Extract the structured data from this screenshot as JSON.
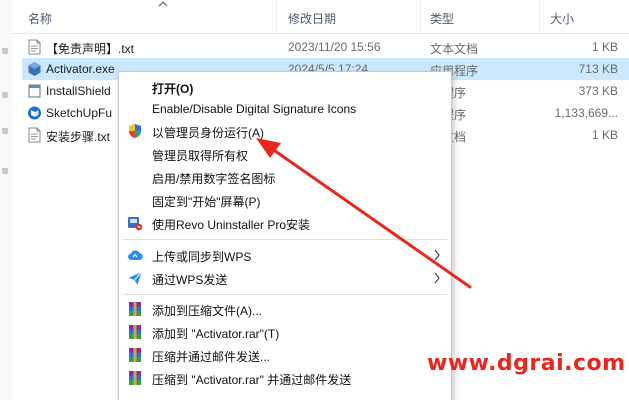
{
  "header": {
    "col_name": "名称",
    "col_date": "修改日期",
    "col_type": "类型",
    "col_size": "大小"
  },
  "files": [
    {
      "name": "【免责声明】.txt",
      "date": "2023/11/20 15:56",
      "type": "文本文档",
      "size": "1 KB",
      "icon": "text-file-icon"
    },
    {
      "name": "Activator.exe",
      "date": "2024/5/5 17:24",
      "type": "应用程序",
      "size": "713 KB",
      "icon": "app-exe-icon"
    },
    {
      "name": "InstallShield",
      "date": "",
      "type": "用程序",
      "size": "373 KB",
      "icon": "app-exe-icon"
    },
    {
      "name": "SketchUpFu",
      "date": "",
      "type": "用程序",
      "size": "1,133,669...",
      "icon": "sketchup-icon"
    },
    {
      "name": "安装步骤.txt",
      "date": "",
      "type": "本文档",
      "size": "1 KB",
      "icon": "text-file-icon"
    }
  ],
  "context_menu": {
    "items": [
      {
        "label": "打开(O)",
        "bold": true
      },
      {
        "label": "Enable/Disable Digital Signature Icons"
      },
      {
        "label": "以管理员身份运行(A)",
        "icon": "uac-shield-icon"
      },
      {
        "label": "管理员取得所有权"
      },
      {
        "label": "启用/禁用数字签名图标"
      },
      {
        "label": "固定到\"开始\"屏幕(P)"
      },
      {
        "label": "使用Revo Uninstaller Pro安装",
        "icon": "revo-uninstaller-icon"
      },
      {
        "label": "上传或同步到WPS",
        "icon": "wps-cloud-icon",
        "submenu": true
      },
      {
        "label": "通过WPS发送",
        "icon": "wps-send-icon",
        "submenu": true
      },
      {
        "label": "添加到压缩文件(A)...",
        "icon": "winrar-icon"
      },
      {
        "label": "添加到 \"Activator.rar\"(T)",
        "icon": "winrar-icon"
      },
      {
        "label": "压缩并通过邮件发送...",
        "icon": "winrar-icon"
      },
      {
        "label": "压缩到 \"Activator.rar\" 并通过邮件发送",
        "icon": "winrar-icon"
      }
    ]
  },
  "watermark": "www.dgrai.com",
  "colors": {
    "selection": "#cce8ff",
    "arrow": "#e8271f",
    "header_text": "#4c5a6e"
  }
}
